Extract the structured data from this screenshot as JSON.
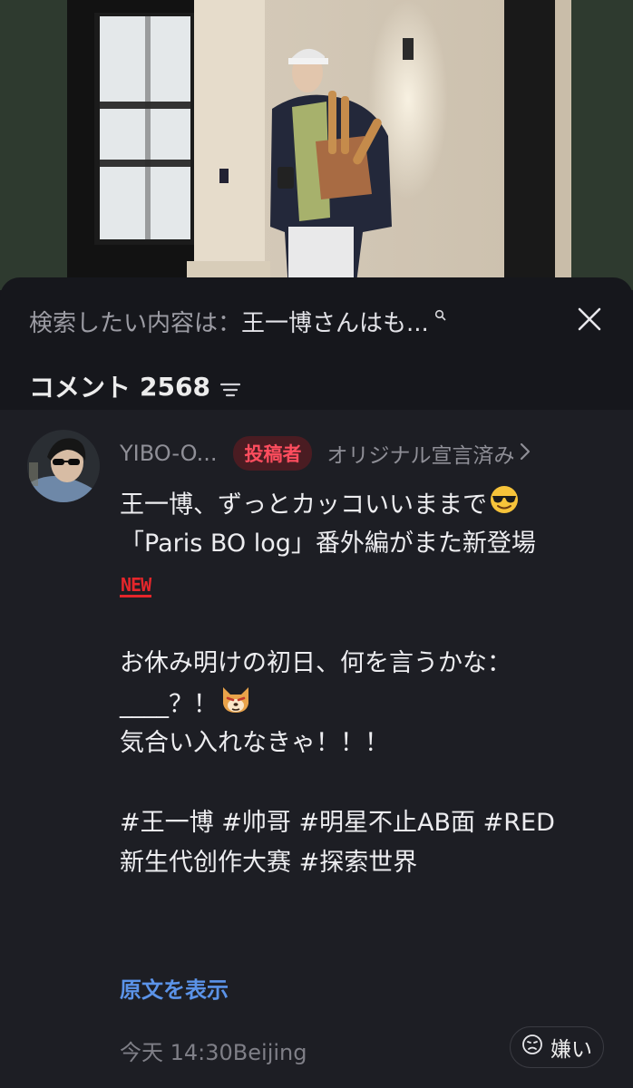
{
  "search": {
    "prefix": "検索したい内容は：",
    "query": "王一博さんはも..."
  },
  "comments_header": {
    "label": "コメント",
    "count": "2568"
  },
  "comment": {
    "username": "YIBO-O...",
    "author_badge": "投稿者",
    "original_declared": "オリジナル宣言済み",
    "lines": {
      "l1": "王一博、ずっとカッコいいままで",
      "l2": "「Paris BO log」番外編がまた新登場",
      "l3_badge": "NEW",
      "l4": "お休み明けの初日、何を言うかな：",
      "l5": "____？！",
      "l6": "気合い入れなきゃ！！！",
      "tags1": [
        "#王一博",
        "#帅哥",
        "#明星不止AB面",
        "#RED"
      ],
      "tags2": [
        "新生代创作大赛",
        "#探索世界"
      ]
    },
    "show_original": "原文を表示",
    "timestamp": "今天 14:30Beijing",
    "dislike_label": "嫌い"
  },
  "icons": {
    "search_hint": "search-icon",
    "close": "close-icon",
    "sort": "sort-icon",
    "chevron": "chevron-right-icon",
    "cool_emoji": "sunglasses-emoji-icon",
    "dog_emoji": "shiba-emoji-icon",
    "dislike": "dislike-face-icon"
  },
  "colors": {
    "background": "#16171c",
    "comment_bg": "#1d1e24",
    "author_badge_bg": "#4a1c22",
    "author_badge_text": "#ff4d5e",
    "link_blue": "#5b93e8",
    "new_badge": "#e5262b"
  }
}
